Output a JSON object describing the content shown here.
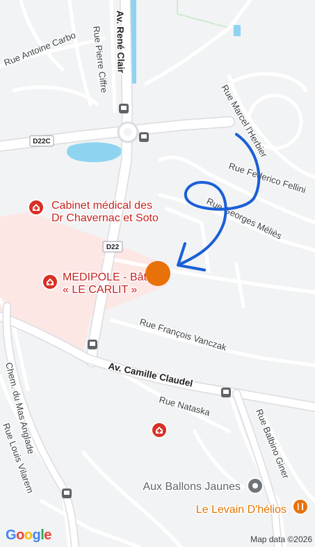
{
  "map": {
    "streets": [
      {
        "id": "rue-antoine-carbo",
        "label": "Rue Antoine Carbo"
      },
      {
        "id": "av-rene-clair",
        "label": "Av. René Clair"
      },
      {
        "id": "rue-pierre-cliffre",
        "label": "Rue Pierre Ciffre"
      },
      {
        "id": "rue-marcel-lherbier",
        "label": "Rue Marcel l'Herbier"
      },
      {
        "id": "rue-federico-fellini",
        "label": "Rue Federico Fellini"
      },
      {
        "id": "rue-georges-melies",
        "label": "Rue Georges Méliès"
      },
      {
        "id": "rue-francois-vanczak",
        "label": "Rue François Vanczak"
      },
      {
        "id": "av-camille-claudel",
        "label": "Av. Camille Claudel"
      },
      {
        "id": "rue-nataska",
        "label": "Rue Nataska"
      },
      {
        "id": "rue-balbino-giner",
        "label": "Rue Balbino Giner"
      },
      {
        "id": "chem-du-mas-anglade",
        "label": "Chem. du Mas Anglade"
      },
      {
        "id": "rue-louis-vilarem",
        "label": "Rue Louis Vilarem"
      }
    ],
    "road_shields": [
      {
        "id": "d22c",
        "label": "D22C"
      },
      {
        "id": "d22",
        "label": "D22"
      }
    ],
    "pois": [
      {
        "id": "cabinet",
        "line1": "Cabinet médical des",
        "line2": "Dr Chavernac et Soto",
        "icon": "medical-cross-icon"
      },
      {
        "id": "medipole",
        "line1": "MEDIPOLE - Bât",
        "line2": "« LE CARLIT »",
        "icon": "medical-cross-icon"
      },
      {
        "id": "ballons",
        "label": "Aux Ballons Jaunes",
        "icon": "store-icon"
      },
      {
        "id": "levain",
        "label": "Le Levain D'hélios",
        "icon": "restaurant-icon"
      }
    ],
    "colors": {
      "background": "#f1f3f4",
      "road": "#ffffff",
      "major_road": "#dadce0",
      "water": "#8ed4f0",
      "medical_area": "#fde7e5",
      "medical_pin": "#d93025",
      "location_marker": "#e8710a",
      "annotation_arrow": "#1a5fd6"
    }
  },
  "footer": {
    "google_logo": "Google",
    "attribution": "Map data ©2026"
  }
}
